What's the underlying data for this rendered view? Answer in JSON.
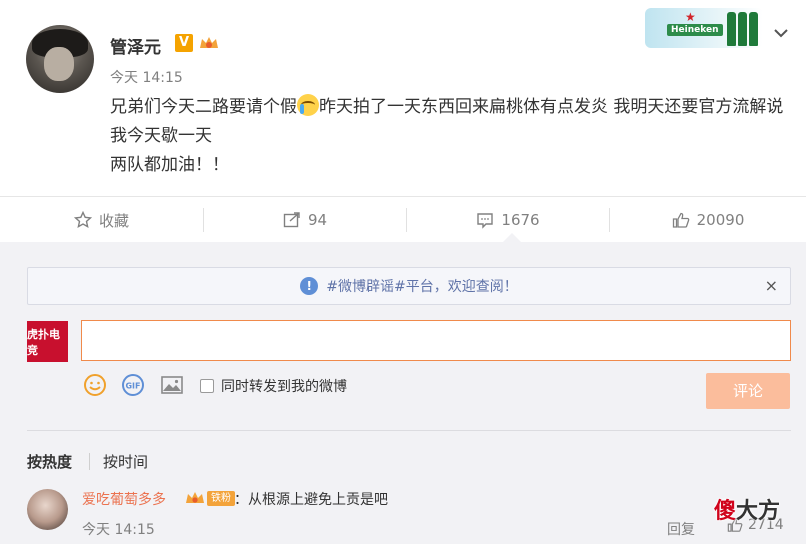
{
  "post": {
    "author": "管泽元",
    "verified_badge": "V",
    "time": "今天 14:15",
    "text_line1": "兄弟们今天二路要请个假",
    "text_after_emoji": "昨天拍了一天东西回来扁桃体有点发炎 我明天还要官方流解说我今天歇一天",
    "text_line3": "两队都加油！！",
    "ad_brand": "Heineken",
    "colors": {
      "name": "#333333",
      "time": "#808080",
      "badge": "#f5a300"
    }
  },
  "actions": {
    "favorite_label": "收藏",
    "repost_count": "94",
    "comment_count": "1676",
    "like_count": "20090"
  },
  "notice": {
    "text": "#微博辟谣#平台，欢迎查阅！",
    "close": "×"
  },
  "composer": {
    "user_logo_text": "虎扑电竞",
    "input_value": "",
    "repost_checkbox_label": "同时转发到我的微博",
    "submit_label": "评论",
    "accent": "#f08a4b"
  },
  "sort": {
    "by_hot": "按热度",
    "by_time": "按时间"
  },
  "comments": [
    {
      "user": "爱吃葡萄多多",
      "badge": "铁粉",
      "text": "：从根源上避免上贡是吧",
      "time": "今天 14:15",
      "reply_label": "回复",
      "like_count": "2714"
    }
  ],
  "watermark": {
    "char1": "傻",
    "rest": "大方"
  }
}
